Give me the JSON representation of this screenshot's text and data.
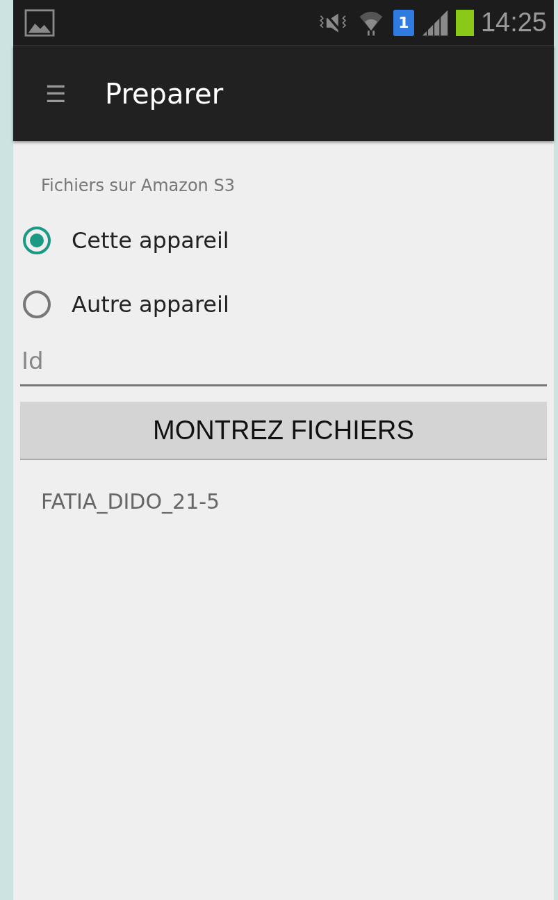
{
  "status_bar": {
    "time": "14:25",
    "sim_label": "1",
    "battery": {
      "level": 1
    }
  },
  "app_bar": {
    "menu_icon": "☰",
    "title": "Preparer"
  },
  "section_label": "Fichiers sur Amazon S3",
  "options": [
    {
      "label": "Cette appareil",
      "selected": true
    },
    {
      "label": "Autre appareil",
      "selected": false
    }
  ],
  "id_field": {
    "placeholder": "Id"
  },
  "button": "MONTREZ FICHIERS",
  "files": [
    "FATIA_DIDO_21-5"
  ]
}
